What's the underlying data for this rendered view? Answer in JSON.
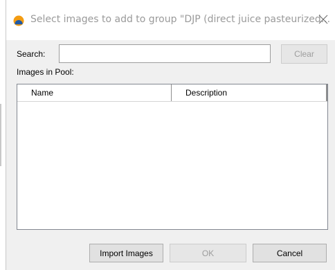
{
  "dialog": {
    "title": "Select images to add to group \"DJP (direct juice pasteurized...",
    "app_icon": "app-logo-icon",
    "close_icon": "close-icon"
  },
  "search": {
    "label": "Search:",
    "value": "",
    "placeholder": "",
    "clear_label": "Clear"
  },
  "pool": {
    "label": "Images in Pool:",
    "columns": [
      "Name",
      "Description"
    ],
    "rows": []
  },
  "footer": {
    "import_label": "Import Images",
    "ok_label": "OK",
    "cancel_label": "Cancel"
  },
  "colors": {
    "icon_orange": "#f39c12",
    "icon_blue": "#1f5aa6",
    "title_text": "#9a9a9a",
    "disabled_text": "#9d9d9d"
  }
}
